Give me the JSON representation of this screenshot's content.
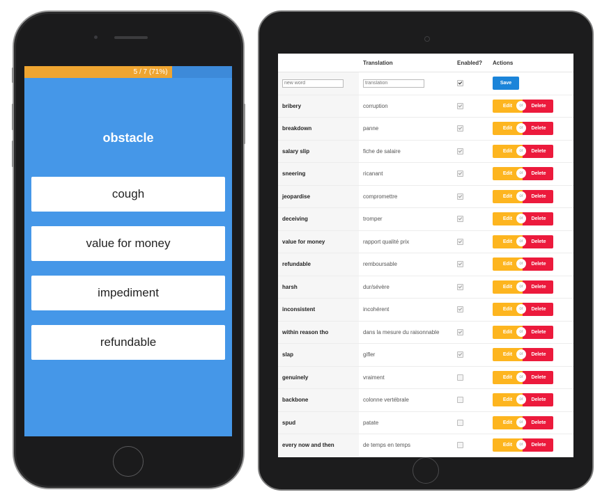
{
  "quiz": {
    "progress_text": "5 / 7 (71%)",
    "progress_fraction": 0.71,
    "question": "obstacle",
    "answers": [
      "cough",
      "value for money",
      "impediment",
      "refundable"
    ]
  },
  "admin": {
    "headers": [
      "",
      "Translation",
      "Enabled?",
      "Actions"
    ],
    "new_word_placeholder": "new word",
    "translation_placeholder": "translation",
    "save_label": "Save",
    "edit_label": "Edit",
    "or_label": "or",
    "delete_label": "Delete",
    "rows": [
      {
        "word": "bribery",
        "translation": "corruption",
        "enabled": true
      },
      {
        "word": "breakdown",
        "translation": "panne",
        "enabled": true
      },
      {
        "word": "salary slip",
        "translation": "fiche de salaire",
        "enabled": true
      },
      {
        "word": "sneering",
        "translation": "ricanant",
        "enabled": true
      },
      {
        "word": "jeopardise",
        "translation": "compromettre",
        "enabled": true
      },
      {
        "word": "deceiving",
        "translation": "tromper",
        "enabled": true
      },
      {
        "word": "value for money",
        "translation": "rapport qualité prix",
        "enabled": true
      },
      {
        "word": "refundable",
        "translation": "remboursable",
        "enabled": true
      },
      {
        "word": "harsh",
        "translation": "dur/sévère",
        "enabled": true
      },
      {
        "word": "inconsistent",
        "translation": "incohérent",
        "enabled": true
      },
      {
        "word": "within reason tho",
        "translation": "dans la mesure du raisonnable",
        "enabled": true
      },
      {
        "word": "slap",
        "translation": "gifler",
        "enabled": true
      },
      {
        "word": "genuinely",
        "translation": "vraiment",
        "enabled": false
      },
      {
        "word": "backbone",
        "translation": "colonne vertébrale",
        "enabled": false
      },
      {
        "word": "spud",
        "translation": "patate",
        "enabled": false
      },
      {
        "word": "every now and then",
        "translation": "de temps en temps",
        "enabled": false
      }
    ]
  },
  "colors": {
    "quiz_background": "#4597e8",
    "progress_fill": "#efa531",
    "save_button": "#1b84d9",
    "edit_button": "#fdb51f",
    "delete_button": "#ec1a3c"
  }
}
